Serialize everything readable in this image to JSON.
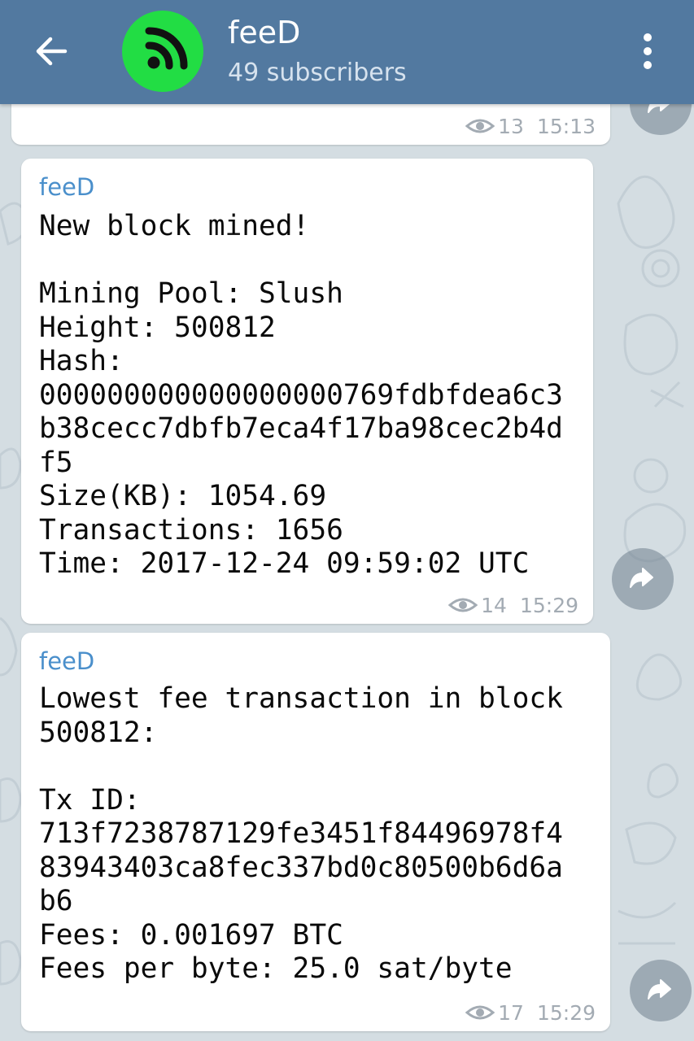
{
  "header": {
    "back_icon": "arrow-left-icon",
    "avatar_icon": "rss-feed-icon",
    "title": "feeD",
    "subtitle": "49 subscribers",
    "menu_icon": "more-vertical-icon",
    "background_color": "#5279a0",
    "avatar_color": "#22dd44"
  },
  "messages": [
    {
      "views": "13",
      "time": "15:13"
    },
    {
      "sender": "feeD",
      "text": "New block mined!\n\nMining Pool: Slush\nHeight: 500812\nHash:\n000000000000000000769fdbfdea6c3\nb38cecc7dbfb7eca4f17ba98cec2b4d\nf5\nSize(KB): 1054.69\nTransactions: 1656\nTime: 2017-12-24 09:59:02 UTC",
      "views": "14",
      "time": "15:29"
    },
    {
      "sender": "feeD",
      "text": "Lowest fee transaction in block\n500812:\n\nTx ID:\n713f7238787129fe3451f84496978f4\n83943403ca8fec337bd0c80500b6d6a\nb6\nFees: 0.001697 BTC\nFees per byte: 25.0 sat/byte",
      "views": "17",
      "time": "15:29"
    }
  ],
  "icons": {
    "views": "eye-icon",
    "share": "share-arrow-icon"
  },
  "colors": {
    "chat_background": "#d4dde2",
    "sender_name": "#4a8fcb",
    "meta_text": "#a3abb3"
  }
}
